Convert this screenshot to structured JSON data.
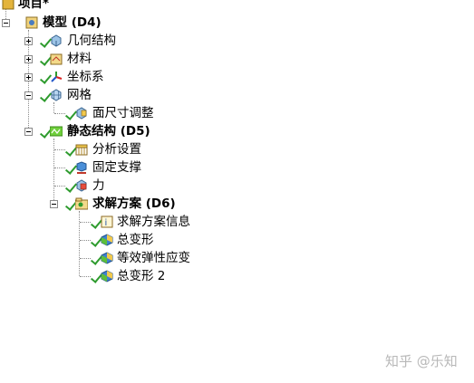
{
  "tree": {
    "root_label": "项目*",
    "model": {
      "label": "模型 (D4)",
      "children": {
        "geometry": "几何结构",
        "materials": "材料",
        "coordinate_systems": "坐标系",
        "mesh": "网格",
        "face_sizing": "面尺寸调整"
      }
    },
    "static_structural": {
      "label": "静态结构 (D5)",
      "analysis_settings": "分析设置",
      "fixed_support": "固定支撑",
      "force": "力",
      "solution": {
        "label": "求解方案 (D6)",
        "solution_information": "求解方案信息",
        "total_deformation": "总变形",
        "equivalent_elastic_strain": "等效弹性应变",
        "total_deformation_2": "总变形 2"
      }
    }
  },
  "watermark": "知乎 @乐知"
}
